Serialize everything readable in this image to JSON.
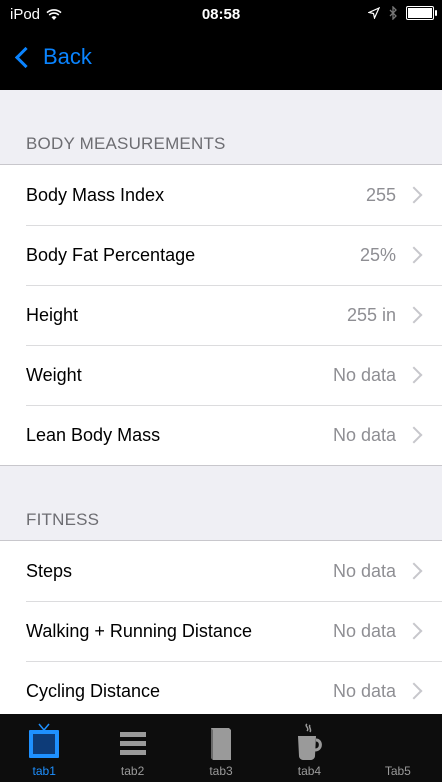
{
  "status": {
    "carrier": "iPod",
    "time": "08:58"
  },
  "nav": {
    "back_label": "Back"
  },
  "sections": [
    {
      "header": "BODY MEASUREMENTS",
      "rows": [
        {
          "label": "Body Mass Index",
          "value": "255"
        },
        {
          "label": "Body Fat Percentage",
          "value": "25%"
        },
        {
          "label": "Height",
          "value": "255 in"
        },
        {
          "label": "Weight",
          "value": "No data"
        },
        {
          "label": "Lean Body Mass",
          "value": "No data"
        }
      ]
    },
    {
      "header": "FITNESS",
      "rows": [
        {
          "label": "Steps",
          "value": "No data"
        },
        {
          "label": "Walking + Running Distance",
          "value": "No data"
        },
        {
          "label": "Cycling Distance",
          "value": "No data"
        }
      ]
    }
  ],
  "tabs": [
    {
      "label": "tab1",
      "icon": "tv-icon",
      "active": true
    },
    {
      "label": "tab2",
      "icon": "list-icon"
    },
    {
      "label": "tab3",
      "icon": "book-icon"
    },
    {
      "label": "tab4",
      "icon": "coffee-cup-icon"
    },
    {
      "label": "Tab5",
      "icon": ""
    }
  ],
  "colors": {
    "accent": "#0a84ff",
    "tab_active": "#1e90ff",
    "background": "#efeff4"
  }
}
